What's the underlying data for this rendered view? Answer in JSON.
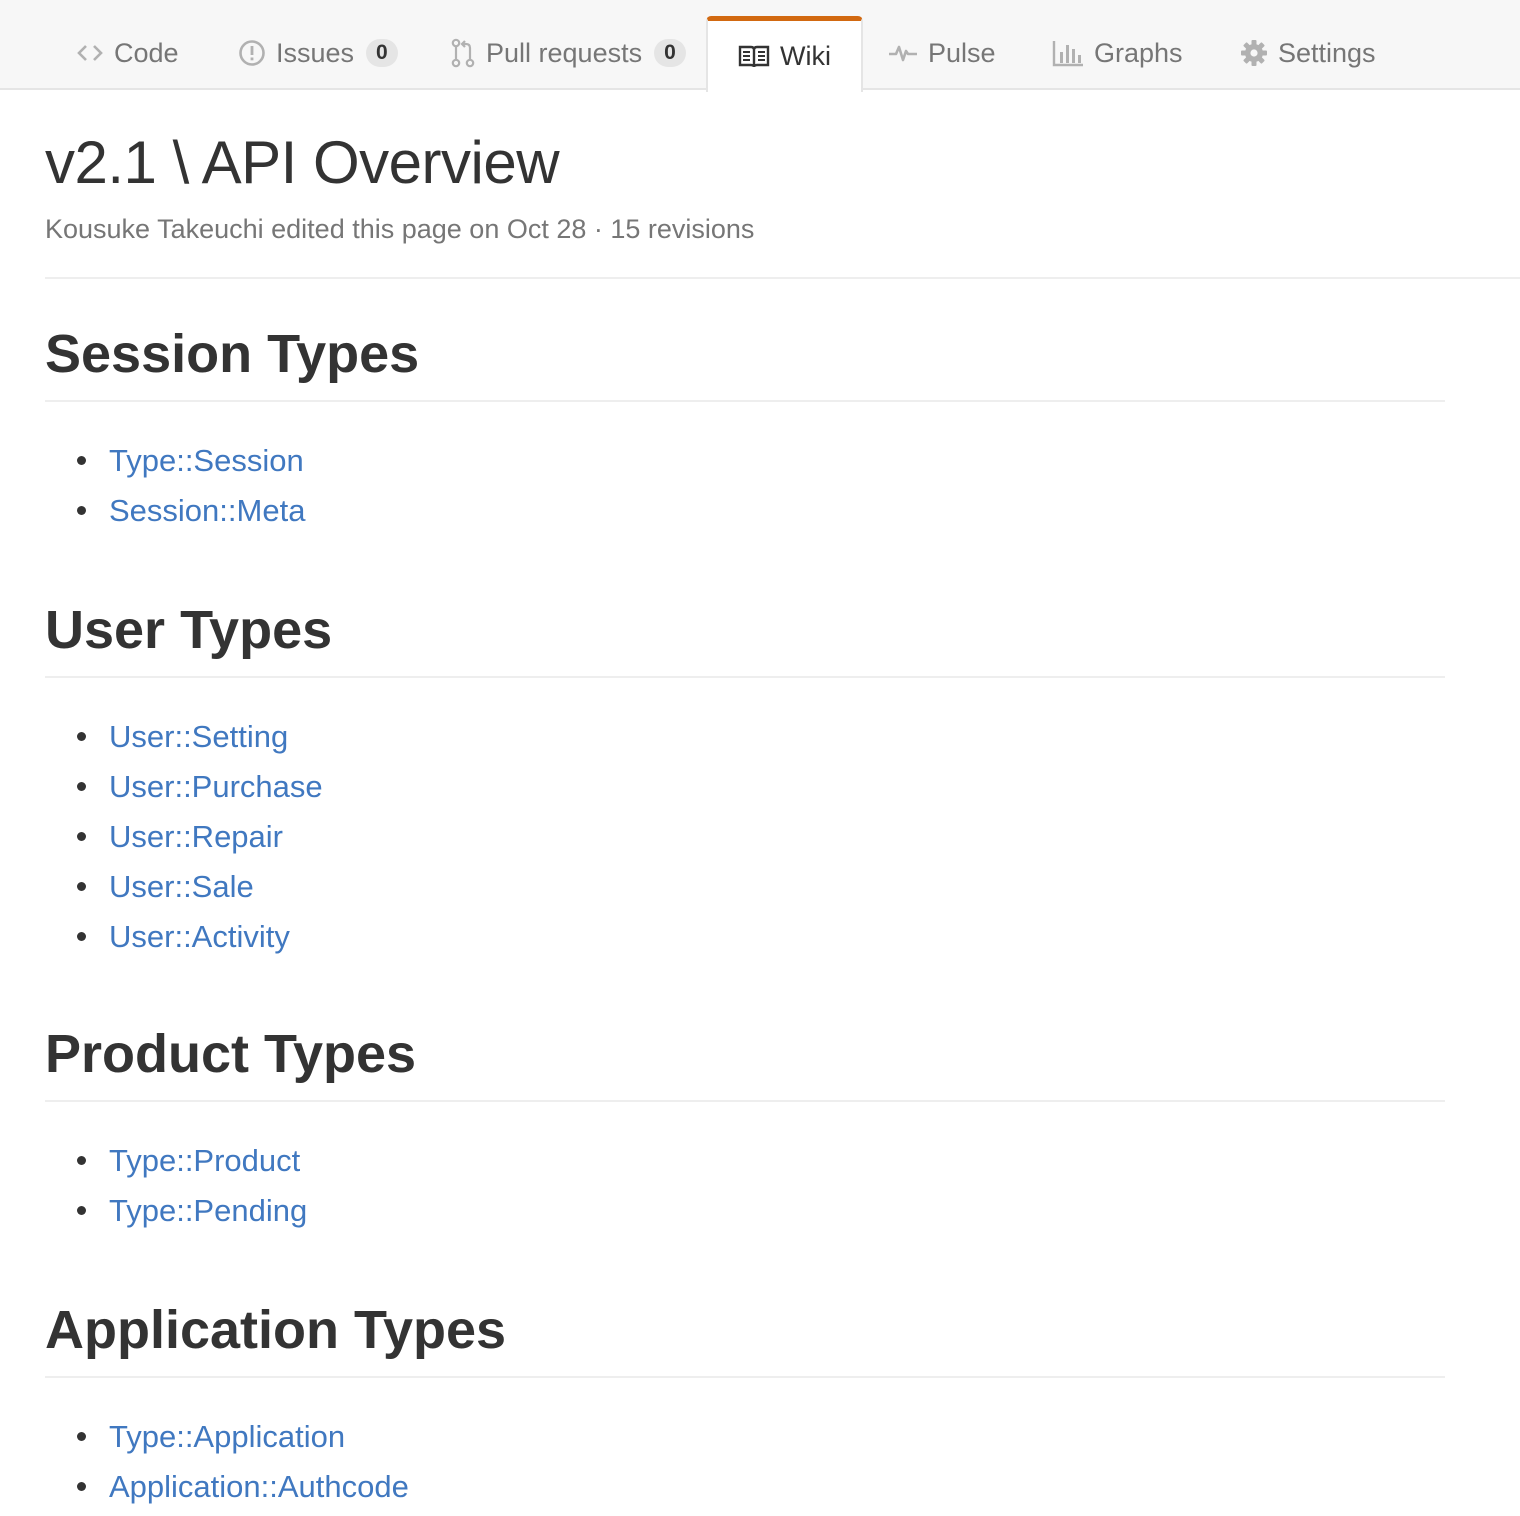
{
  "tabs": [
    {
      "key": "code",
      "label": "Code",
      "icon": "code-icon",
      "counter": null,
      "selected": false
    },
    {
      "key": "issues",
      "label": "Issues",
      "icon": "issue-opened-icon",
      "counter": "0",
      "selected": false
    },
    {
      "key": "pulls",
      "label": "Pull requests",
      "icon": "git-pull-request-icon",
      "counter": "0",
      "selected": false
    },
    {
      "key": "wiki",
      "label": "Wiki",
      "icon": "book-icon",
      "counter": null,
      "selected": true
    },
    {
      "key": "pulse",
      "label": "Pulse",
      "icon": "pulse-icon",
      "counter": null,
      "selected": false
    },
    {
      "key": "graphs",
      "label": "Graphs",
      "icon": "graph-icon",
      "counter": null,
      "selected": false
    },
    {
      "key": "settings",
      "label": "Settings",
      "icon": "gear-icon",
      "counter": null,
      "selected": false
    }
  ],
  "page": {
    "title": "v2.1 \\ API Overview",
    "meta": "Kousuke Takeuchi edited this page on Oct 28 · 15 revisions"
  },
  "sections": [
    {
      "heading": "Session Types",
      "links": [
        "Type::Session",
        "Session::Meta"
      ]
    },
    {
      "heading": "User Types",
      "links": [
        "User::Setting",
        "User::Purchase",
        "User::Repair",
        "User::Sale",
        "User::Activity"
      ]
    },
    {
      "heading": "Product Types",
      "links": [
        "Type::Product",
        "Type::Pending"
      ]
    },
    {
      "heading": "Application Types",
      "links": [
        "Type::Application",
        "Application::Authcode"
      ]
    }
  ],
  "colors": {
    "link": "#4078c0",
    "selected_tab_accent": "#d26911",
    "text": "#333333",
    "muted_text": "#767676",
    "tabbar_background": "#f7f7f7"
  }
}
